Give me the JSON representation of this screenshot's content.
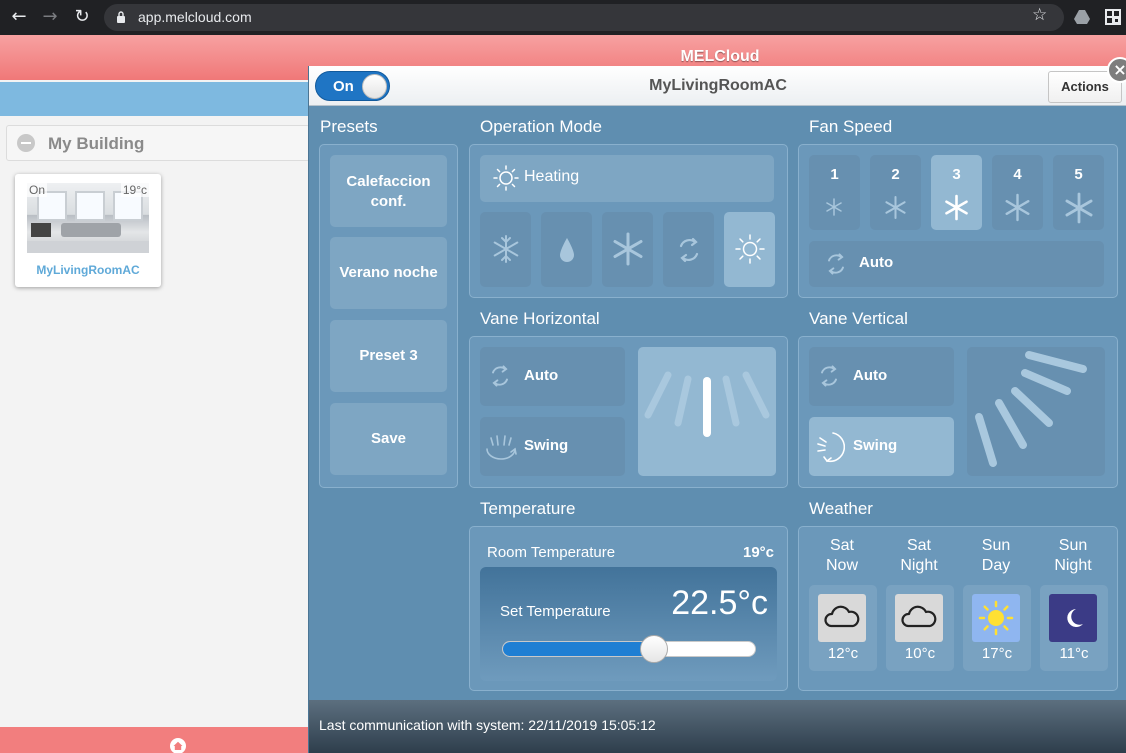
{
  "browser": {
    "url": "app.melcloud.com"
  },
  "app": {
    "title": "MELCloud"
  },
  "sidebar": {
    "building_label": "My Building",
    "device_card": {
      "status": "On",
      "temperature": "19°c",
      "name": "MyLivingRoomAC"
    }
  },
  "modal": {
    "power_toggle_label": "On",
    "power_on": true,
    "title": "MyLivingRoomAC",
    "actions_label": "Actions",
    "close_label": "×",
    "presets": {
      "title": "Presets",
      "items": [
        "Calefaccion conf.",
        "Verano noche",
        "Preset 3",
        "Save"
      ]
    },
    "operation_mode": {
      "title": "Operation Mode",
      "current_label": "Heating",
      "modes": [
        "heat",
        "dry",
        "cool",
        "fan",
        "heat"
      ],
      "mode_icons": [
        "snowflake-icon",
        "droplet-icon",
        "snowflake-large-icon",
        "recycle-icon",
        "sun-icon"
      ],
      "selected_index": 4
    },
    "fan_speed": {
      "title": "Fan Speed",
      "levels": [
        "1",
        "2",
        "3",
        "4",
        "5"
      ],
      "selected_index": 2,
      "auto_label": "Auto"
    },
    "vane_horizontal": {
      "title": "Vane Horizontal",
      "auto_label": "Auto",
      "swing_label": "Swing"
    },
    "vane_vertical": {
      "title": "Vane Vertical",
      "auto_label": "Auto",
      "swing_label": "Swing",
      "selected": "swing"
    },
    "temperature": {
      "title": "Temperature",
      "room_label": "Room Temperature",
      "room_value": "19°c",
      "set_label": "Set Temperature",
      "set_value": "22.5°c",
      "slider_fraction": 0.6
    },
    "weather": {
      "title": "Weather",
      "days": [
        {
          "line1": "Sat",
          "line2": "Now",
          "temp": "12°c",
          "icon": "cloud-icon"
        },
        {
          "line1": "Sat",
          "line2": "Night",
          "temp": "10°c",
          "icon": "cloud-icon"
        },
        {
          "line1": "Sun",
          "line2": "Day",
          "temp": "17°c",
          "icon": "sun-icon"
        },
        {
          "line1": "Sun",
          "line2": "Night",
          "temp": "11°c",
          "icon": "moon-icon"
        }
      ]
    },
    "status": "Last communication with system: 22/11/2019 15:05:12"
  },
  "colors": {
    "header_pink": "#f07878",
    "modal_blue": "#5f8eb0",
    "toggle_blue": "#1f75c4",
    "link_blue": "#5fa9d8"
  }
}
